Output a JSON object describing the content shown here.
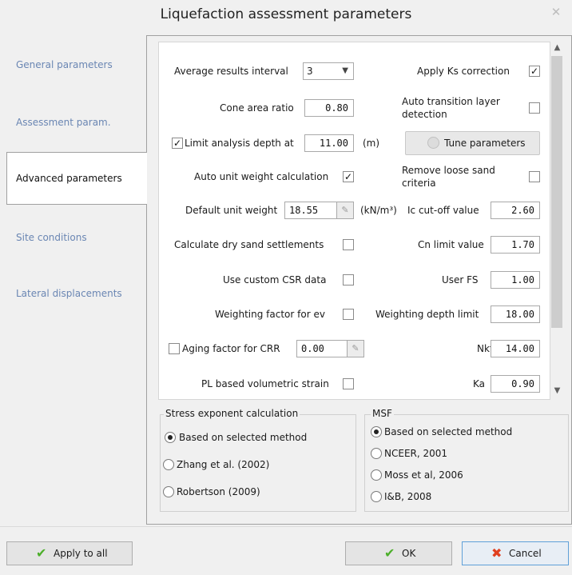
{
  "window": {
    "title": "Liquefaction assessment parameters",
    "close_icon": "close-icon"
  },
  "nav": {
    "items": [
      {
        "label": "General parameters"
      },
      {
        "label": "Assessment param."
      },
      {
        "label": "Advanced parameters",
        "active": true
      },
      {
        "label": "Site conditions"
      },
      {
        "label": "Lateral displacements"
      }
    ]
  },
  "left": {
    "avg_interval_label": "Average results interval",
    "avg_interval_value": "3",
    "cone_area_label": "Cone area ratio",
    "cone_area_value": "0.80",
    "limit_depth_label": "Limit analysis depth at",
    "limit_depth_checked": true,
    "limit_depth_value": "11.00",
    "limit_depth_unit": "(m)",
    "auto_unit_weight_label": "Auto unit weight calculation",
    "auto_unit_weight_checked": true,
    "default_unit_weight_label": "Default unit weight",
    "default_unit_weight_value": "18.55",
    "default_unit_weight_unit": "(kN/m³)",
    "dry_sand_label": "Calculate dry sand settlements",
    "custom_csr_label": "Use custom CSR data",
    "weighting_ev_label": "Weighting factor for ev",
    "aging_label": "Aging factor for CRR",
    "aging_value": "0.00",
    "pl_strain_label": "PL based volumetric strain"
  },
  "right": {
    "ks_label": "Apply Ks correction",
    "ks_checked": true,
    "auto_transition_label_1": "Auto transition layer",
    "auto_transition_label_2": "detection",
    "tune_label": "Tune parameters",
    "remove_loose_label_1": "Remove loose sand",
    "remove_loose_label_2": "criteria",
    "ic_cutoff_label": "Ic cut-off value",
    "ic_cutoff_value": "2.60",
    "cn_limit_label": "Cn limit value",
    "cn_limit_value": "1.70",
    "user_fs_label": "User FS",
    "user_fs_value": "1.00",
    "weighting_depth_label": "Weighting depth limit",
    "weighting_depth_value": "18.00",
    "nkt_label": "Nkt",
    "nkt_value": "14.00",
    "ka_label": "Ka",
    "ka_value": "0.90"
  },
  "stress_group": {
    "title": "Stress exponent calculation",
    "options": [
      "Based on selected method",
      "Zhang et al. (2002)",
      "Robertson (2009)"
    ],
    "selected": 0
  },
  "msf_group": {
    "title": "MSF",
    "options": [
      "Based on selected method",
      "NCEER, 2001",
      "Moss et al, 2006",
      "I&B, 2008"
    ],
    "selected": 0
  },
  "buttons": {
    "apply_all": "Apply to all",
    "ok": "OK",
    "cancel": "Cancel"
  },
  "check_mark": "✓"
}
